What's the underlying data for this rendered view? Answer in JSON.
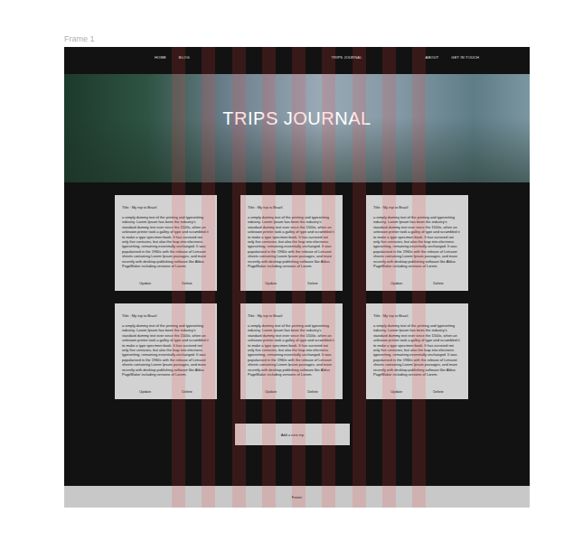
{
  "canvas": {
    "frame_label": "Frame 1"
  },
  "nav": {
    "left": [
      "HOME",
      "BLOG"
    ],
    "brand": "TRIPS JOURNAL",
    "right": [
      "ABOUT",
      "GET IN TOUCH"
    ]
  },
  "hero": {
    "title": "TRIPS JOURNAL"
  },
  "cards": [
    {
      "title": "Title : My trip to Brazil",
      "body": "a simply dummy text of the printing and typesetting industry. Lorem Ipsum has been the industry's standard dummy text ever since the 1500s, when an unknown printer took a galley of type and scrambled it to make a type specimen book. It has survived not only five centuries, but also the leap into electronic typesetting, remaining essentially unchanged. It was popularised in the 1960s with the release of Letraset sheets containing Lorem Ipsum passages, and more recently with desktop publishing software like Aldus PageMaker including versions of Lorem.",
      "actions": [
        "Update",
        "Delete"
      ]
    },
    {
      "title": "Title : My trip to Brazil",
      "body": "a simply dummy text of the printing and typesetting industry. Lorem Ipsum has been the industry's standard dummy text ever since the 1500s, when an unknown printer took a galley of type and scrambled it to make a type specimen book. It has survived not only five centuries, but also the leap into electronic typesetting, remaining essentially unchanged. It was popularised in the 1960s with the release of Letraset sheets containing Lorem Ipsum passages, and more recently with desktop publishing software like Aldus PageMaker including versions of Lorem.",
      "actions": [
        "Update",
        "Delete"
      ]
    },
    {
      "title": "Title : My trip to Brazil",
      "body": "a simply dummy text of the printing and typesetting industry. Lorem Ipsum has been the industry's standard dummy text ever since the 1500s, when an unknown printer took a galley of type and scrambled it to make a type specimen book. It has survived not only five centuries, but also the leap into electronic typesetting, remaining essentially unchanged. It was popularised in the 1960s with the release of Letraset sheets containing Lorem Ipsum passages, and more recently with desktop publishing software like Aldus PageMaker including versions of Lorem.",
      "actions": [
        "Update",
        "Delete"
      ]
    },
    {
      "title": "Title : My trip to Brazil",
      "body": "a simply dummy text of the printing and typesetting industry. Lorem Ipsum has been the industry's standard dummy text ever since the 1500s, when an unknown printer took a galley of type and scrambled it to make a type specimen book. It has survived not only five centuries, but also the leap into electronic typesetting, remaining essentially unchanged. It was popularised in the 1960s with the release of Letraset sheets containing Lorem Ipsum passages, and more recently with desktop publishing software like Aldus PageMaker including versions of Lorem.",
      "actions": [
        "Update",
        "Delete"
      ]
    },
    {
      "title": "Title : My trip to Brazil",
      "body": "a simply dummy text of the printing and typesetting industry. Lorem Ipsum has been the industry's standard dummy text ever since the 1500s, when an unknown printer took a galley of type and scrambled it to make a type specimen book. It has survived not only five centuries, but also the leap into electronic typesetting, remaining essentially unchanged. It was popularised in the 1960s with the release of Letraset sheets containing Lorem Ipsum passages, and more recently with desktop publishing software like Aldus PageMaker including versions of Lorem.",
      "actions": [
        "Update",
        "Delete"
      ]
    },
    {
      "title": "Title : My trip to Brazil",
      "body": "a simply dummy text of the printing and typesetting industry. Lorem Ipsum has been the industry's standard dummy text ever since the 1500s, when an unknown printer took a galley of type and scrambled it to make a type specimen book. It has survived not only five centuries, but also the leap into electronic typesetting, remaining essentially unchanged. It was popularised in the 1960s with the release of Letraset sheets containing Lorem Ipsum passages, and more recently with desktop publishing software like Aldus PageMaker including versions of Lorem.",
      "actions": [
        "Update",
        "Delete"
      ]
    }
  ],
  "add_button": "Add a new trip",
  "footer": "Footer"
}
